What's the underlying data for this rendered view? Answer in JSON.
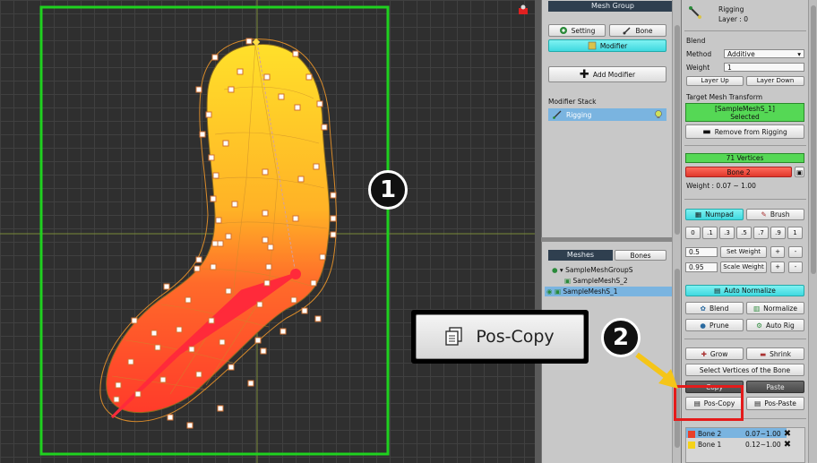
{
  "callouts": {
    "one": "1",
    "two": "2"
  },
  "big_button": {
    "label": "Pos-Copy",
    "icon": "paste-doc-icon"
  },
  "mesh_group": {
    "header": "Mesh Group",
    "setting_label": "Setting",
    "bone_label": "Bone",
    "modifier_label": "Modifier",
    "add_modifier_label": "Add Modifier",
    "modifier_stack_label": "Modifier Stack",
    "rigging_label": "Rigging"
  },
  "hierarchy": {
    "tab_meshes": "Meshes",
    "tab_bones": "Bones",
    "items": [
      {
        "label": "SampleMeshGroupS",
        "selected": false
      },
      {
        "label": "SampleMeshS_2",
        "selected": false
      },
      {
        "label": "SampleMeshS_1",
        "selected": true
      }
    ]
  },
  "inspector": {
    "title": "Rigging",
    "layer": "Layer : 0",
    "blend_label": "Blend",
    "method_label": "Method",
    "method_value": "Additive",
    "weight_label": "Weight",
    "weight_value": "1",
    "layer_up": "Layer Up",
    "layer_down": "Layer Down",
    "target_label": "Target Mesh Transform",
    "target_name": "[SampleMeshS_1]",
    "target_status": "Selected",
    "remove_label": "Remove from Rigging",
    "vertices_label": "71 Vertices",
    "bone_selected": "Bone 2",
    "weight_range": "Weight : 0.07 ~ 1.00",
    "numpad_label": "Numpad",
    "brush_label": "Brush",
    "numpad_keys": [
      "0",
      ".1",
      ".3",
      ".5",
      ".7",
      ".9",
      "1"
    ],
    "set_weight_value": "0.5",
    "set_weight_label": "Set Weight",
    "scale_weight_value": "0.95",
    "scale_weight_label": "Scale Weight",
    "plus": "+",
    "minus": "-",
    "auto_normalize": "Auto Normalize",
    "blend_btn": "Blend",
    "normalize_btn": "Normalize",
    "prune_btn": "Prune",
    "auto_rig_btn": "Auto Rig",
    "grow_btn": "Grow",
    "shrink_btn": "Shrink",
    "select_vertices": "Select Vertices of the Bone",
    "copy_btn": "Copy",
    "paste_btn": "Paste",
    "pos_copy_btn": "Pos-Copy",
    "pos_paste_btn": "Pos-Paste",
    "bones": [
      {
        "name": "Bone 2",
        "range": "0.07~1.00",
        "color": "#e8402a",
        "selected": true
      },
      {
        "name": "Bone 1",
        "range": "0.12~1.00",
        "color": "#f5d21a",
        "selected": false
      }
    ]
  },
  "colors": {
    "accent_green": "#1fd11f",
    "highlight_red": "#e41b1b",
    "selection_blue": "#7ab4e0"
  }
}
